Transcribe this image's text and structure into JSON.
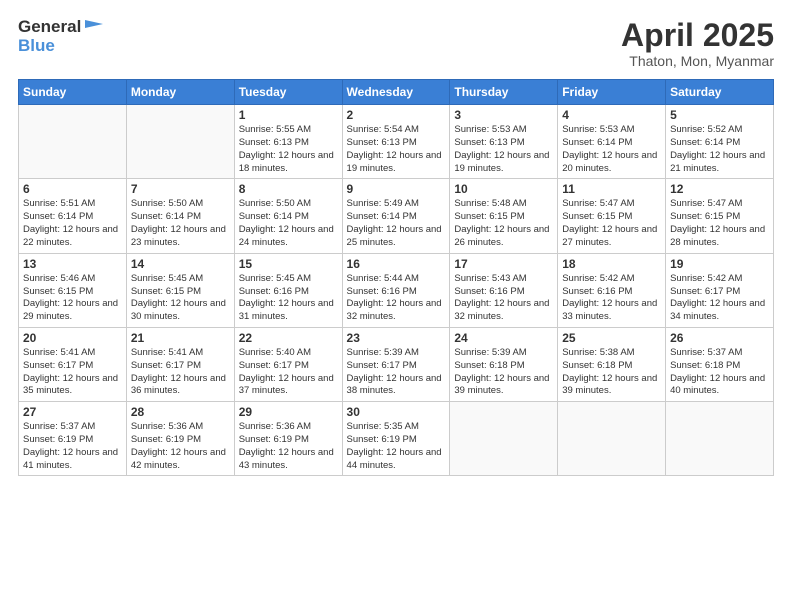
{
  "header": {
    "logo_general": "General",
    "logo_blue": "Blue",
    "title": "April 2025",
    "subtitle": "Thaton, Mon, Myanmar"
  },
  "columns": [
    "Sunday",
    "Monday",
    "Tuesday",
    "Wednesday",
    "Thursday",
    "Friday",
    "Saturday"
  ],
  "weeks": [
    [
      {
        "day": "",
        "sunrise": "",
        "sunset": "",
        "daylight": ""
      },
      {
        "day": "",
        "sunrise": "",
        "sunset": "",
        "daylight": ""
      },
      {
        "day": "1",
        "sunrise": "Sunrise: 5:55 AM",
        "sunset": "Sunset: 6:13 PM",
        "daylight": "Daylight: 12 hours and 18 minutes."
      },
      {
        "day": "2",
        "sunrise": "Sunrise: 5:54 AM",
        "sunset": "Sunset: 6:13 PM",
        "daylight": "Daylight: 12 hours and 19 minutes."
      },
      {
        "day": "3",
        "sunrise": "Sunrise: 5:53 AM",
        "sunset": "Sunset: 6:13 PM",
        "daylight": "Daylight: 12 hours and 19 minutes."
      },
      {
        "day": "4",
        "sunrise": "Sunrise: 5:53 AM",
        "sunset": "Sunset: 6:14 PM",
        "daylight": "Daylight: 12 hours and 20 minutes."
      },
      {
        "day": "5",
        "sunrise": "Sunrise: 5:52 AM",
        "sunset": "Sunset: 6:14 PM",
        "daylight": "Daylight: 12 hours and 21 minutes."
      }
    ],
    [
      {
        "day": "6",
        "sunrise": "Sunrise: 5:51 AM",
        "sunset": "Sunset: 6:14 PM",
        "daylight": "Daylight: 12 hours and 22 minutes."
      },
      {
        "day": "7",
        "sunrise": "Sunrise: 5:50 AM",
        "sunset": "Sunset: 6:14 PM",
        "daylight": "Daylight: 12 hours and 23 minutes."
      },
      {
        "day": "8",
        "sunrise": "Sunrise: 5:50 AM",
        "sunset": "Sunset: 6:14 PM",
        "daylight": "Daylight: 12 hours and 24 minutes."
      },
      {
        "day": "9",
        "sunrise": "Sunrise: 5:49 AM",
        "sunset": "Sunset: 6:14 PM",
        "daylight": "Daylight: 12 hours and 25 minutes."
      },
      {
        "day": "10",
        "sunrise": "Sunrise: 5:48 AM",
        "sunset": "Sunset: 6:15 PM",
        "daylight": "Daylight: 12 hours and 26 minutes."
      },
      {
        "day": "11",
        "sunrise": "Sunrise: 5:47 AM",
        "sunset": "Sunset: 6:15 PM",
        "daylight": "Daylight: 12 hours and 27 minutes."
      },
      {
        "day": "12",
        "sunrise": "Sunrise: 5:47 AM",
        "sunset": "Sunset: 6:15 PM",
        "daylight": "Daylight: 12 hours and 28 minutes."
      }
    ],
    [
      {
        "day": "13",
        "sunrise": "Sunrise: 5:46 AM",
        "sunset": "Sunset: 6:15 PM",
        "daylight": "Daylight: 12 hours and 29 minutes."
      },
      {
        "day": "14",
        "sunrise": "Sunrise: 5:45 AM",
        "sunset": "Sunset: 6:15 PM",
        "daylight": "Daylight: 12 hours and 30 minutes."
      },
      {
        "day": "15",
        "sunrise": "Sunrise: 5:45 AM",
        "sunset": "Sunset: 6:16 PM",
        "daylight": "Daylight: 12 hours and 31 minutes."
      },
      {
        "day": "16",
        "sunrise": "Sunrise: 5:44 AM",
        "sunset": "Sunset: 6:16 PM",
        "daylight": "Daylight: 12 hours and 32 minutes."
      },
      {
        "day": "17",
        "sunrise": "Sunrise: 5:43 AM",
        "sunset": "Sunset: 6:16 PM",
        "daylight": "Daylight: 12 hours and 32 minutes."
      },
      {
        "day": "18",
        "sunrise": "Sunrise: 5:42 AM",
        "sunset": "Sunset: 6:16 PM",
        "daylight": "Daylight: 12 hours and 33 minutes."
      },
      {
        "day": "19",
        "sunrise": "Sunrise: 5:42 AM",
        "sunset": "Sunset: 6:17 PM",
        "daylight": "Daylight: 12 hours and 34 minutes."
      }
    ],
    [
      {
        "day": "20",
        "sunrise": "Sunrise: 5:41 AM",
        "sunset": "Sunset: 6:17 PM",
        "daylight": "Daylight: 12 hours and 35 minutes."
      },
      {
        "day": "21",
        "sunrise": "Sunrise: 5:41 AM",
        "sunset": "Sunset: 6:17 PM",
        "daylight": "Daylight: 12 hours and 36 minutes."
      },
      {
        "day": "22",
        "sunrise": "Sunrise: 5:40 AM",
        "sunset": "Sunset: 6:17 PM",
        "daylight": "Daylight: 12 hours and 37 minutes."
      },
      {
        "day": "23",
        "sunrise": "Sunrise: 5:39 AM",
        "sunset": "Sunset: 6:17 PM",
        "daylight": "Daylight: 12 hours and 38 minutes."
      },
      {
        "day": "24",
        "sunrise": "Sunrise: 5:39 AM",
        "sunset": "Sunset: 6:18 PM",
        "daylight": "Daylight: 12 hours and 39 minutes."
      },
      {
        "day": "25",
        "sunrise": "Sunrise: 5:38 AM",
        "sunset": "Sunset: 6:18 PM",
        "daylight": "Daylight: 12 hours and 39 minutes."
      },
      {
        "day": "26",
        "sunrise": "Sunrise: 5:37 AM",
        "sunset": "Sunset: 6:18 PM",
        "daylight": "Daylight: 12 hours and 40 minutes."
      }
    ],
    [
      {
        "day": "27",
        "sunrise": "Sunrise: 5:37 AM",
        "sunset": "Sunset: 6:19 PM",
        "daylight": "Daylight: 12 hours and 41 minutes."
      },
      {
        "day": "28",
        "sunrise": "Sunrise: 5:36 AM",
        "sunset": "Sunset: 6:19 PM",
        "daylight": "Daylight: 12 hours and 42 minutes."
      },
      {
        "day": "29",
        "sunrise": "Sunrise: 5:36 AM",
        "sunset": "Sunset: 6:19 PM",
        "daylight": "Daylight: 12 hours and 43 minutes."
      },
      {
        "day": "30",
        "sunrise": "Sunrise: 5:35 AM",
        "sunset": "Sunset: 6:19 PM",
        "daylight": "Daylight: 12 hours and 44 minutes."
      },
      {
        "day": "",
        "sunrise": "",
        "sunset": "",
        "daylight": ""
      },
      {
        "day": "",
        "sunrise": "",
        "sunset": "",
        "daylight": ""
      },
      {
        "day": "",
        "sunrise": "",
        "sunset": "",
        "daylight": ""
      }
    ]
  ]
}
